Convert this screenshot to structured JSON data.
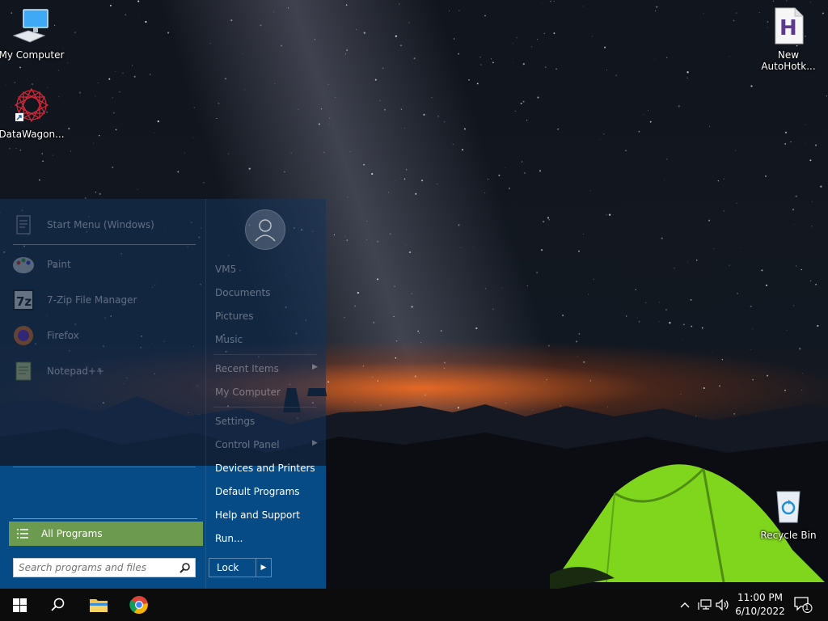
{
  "desktop": {
    "icons": [
      {
        "label": "My Computer",
        "icon": "monitor-icon"
      },
      {
        "label": "DataWagon...",
        "icon": "mandala-shortcut-icon"
      },
      {
        "label": "New AutoHotk...",
        "icon": "autohotkey-script-icon"
      },
      {
        "label": "Recycle Bin",
        "icon": "recycle-bin-icon"
      }
    ]
  },
  "start_menu": {
    "header": "Start Menu (Windows)",
    "pinned": [
      {
        "label": "Paint",
        "icon": "paint-icon"
      },
      {
        "label": "7-Zip File Manager",
        "icon": "7zip-icon"
      },
      {
        "label": "Firefox",
        "icon": "firefox-icon"
      },
      {
        "label": "Notepad++",
        "icon": "notepadpp-icon"
      }
    ],
    "right_items": [
      {
        "label": "VM5"
      },
      {
        "label": "Documents"
      },
      {
        "label": "Pictures"
      },
      {
        "label": "Music"
      },
      {
        "label": "Recent Items"
      },
      {
        "label": "My Computer"
      },
      {
        "label": "Settings"
      },
      {
        "label": "Control Panel"
      },
      {
        "label": "Devices and Printers"
      },
      {
        "label": "Default Programs"
      },
      {
        "label": "Help and Support"
      },
      {
        "label": "Run..."
      }
    ],
    "all_programs": "All Programs",
    "search_placeholder": "Search programs and files",
    "lock_label": "Lock"
  },
  "taskbar": {
    "buttons": [
      "windows-start-icon",
      "search-icon",
      "file-explorer-icon",
      "chrome-icon"
    ],
    "tray": [
      "chevron-up-icon",
      "network-icon",
      "volume-icon"
    ],
    "time": "11:00 PM",
    "date": "6/10/2022",
    "notification_count": "1"
  },
  "colors": {
    "start_menu_blue": "#064b85",
    "all_programs_green": "#6c9a4f",
    "taskbar": "#0c0c0c",
    "tent_green": "#7fd61c"
  }
}
